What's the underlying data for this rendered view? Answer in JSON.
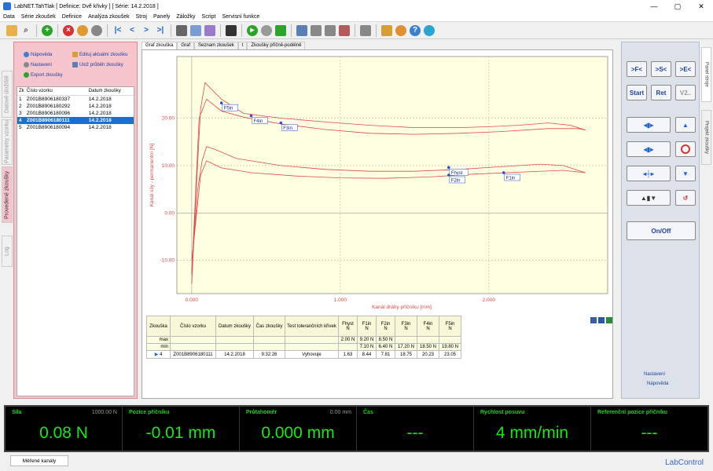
{
  "window": {
    "title": "LabNET.TahTlak [ Definice: Dvě křivky ]  [ Série: 14.2.2018 ]",
    "controls": [
      "—",
      "▢",
      "✕"
    ]
  },
  "menu": [
    "Data",
    "Série zkoušek",
    "Definice",
    "Analýza zkoušek",
    "Stroj",
    "Panely",
    "Záložky",
    "Script",
    "Servisní funkce"
  ],
  "left_tabs": [
    "Datové úložiště",
    "Parametry vzorku",
    "Provedené zkoušky",
    "Log"
  ],
  "left_links": {
    "help": "Nápověda",
    "settings": "Nastavení",
    "export": "Export zkoušky",
    "edit": "Edituj aktuální zkoušku",
    "save_curve": "Ulož průběh zkoušky"
  },
  "samples": {
    "headers": [
      "Zk",
      "Číslo vzorku",
      "Datum zkoušky"
    ],
    "rows": [
      {
        "n": "1",
        "id": "Z001B8906180337",
        "date": "14.2.2018"
      },
      {
        "n": "2",
        "id": "Z001B8906180292",
        "date": "14.2.2018"
      },
      {
        "n": "3",
        "id": "Z001B8906180096",
        "date": "14.2.2018"
      },
      {
        "n": "4",
        "id": "Z001B8906180111",
        "date": "14.2.2018"
      },
      {
        "n": "5",
        "id": "Z001B8906180094",
        "date": "14.2.2018"
      }
    ]
  },
  "center_tabs": [
    "Graf zkouška",
    "Graf",
    "Seznam zkoušek",
    "t",
    "Zkoušky příčně-podélně"
  ],
  "chart_data": {
    "type": "line",
    "xlabel": "Kanál dráhy příčníku  [mm]",
    "ylabel": "Kanál síly - permanentní  [N]",
    "xticks": [
      "0.000",
      "1.000",
      "2.000"
    ],
    "yticks": [
      "20.00",
      "10.00",
      "0.00",
      "-10.00"
    ],
    "xlim": [
      -0.1,
      2.8
    ],
    "ylim": [
      -17,
      33
    ],
    "grid": true,
    "series": [
      {
        "x": [
          0.0,
          0.03,
          0.06,
          0.09,
          0.12,
          0.2,
          0.35,
          0.6,
          0.9,
          1.2,
          1.5,
          1.8,
          2.0,
          2.2,
          2.4,
          2.55,
          2.65
        ],
        "y": [
          -15,
          5,
          22,
          27.5,
          26.5,
          24,
          21,
          20,
          19.2,
          18.5,
          18,
          18,
          18.2,
          18.5,
          19,
          18.5,
          17.5
        ]
      },
      {
        "x": [
          0.0,
          0.05,
          0.1,
          0.2,
          0.35,
          0.6,
          0.9,
          1.2,
          1.5,
          1.8,
          2.1,
          2.4,
          2.6,
          2.65
        ],
        "y": [
          -13,
          20,
          24,
          21.5,
          20.2,
          18.8,
          17.6,
          16.8,
          16.6,
          16.8,
          17.2,
          17.8,
          17.8,
          17.5
        ]
      },
      {
        "x": [
          0.0,
          0.04,
          0.07,
          0.1,
          0.15,
          0.3,
          0.6,
          0.9,
          1.2,
          1.5,
          1.8,
          2.1,
          2.35,
          2.5,
          2.65
        ],
        "y": [
          -12,
          5,
          11,
          14,
          13.5,
          11.5,
          10,
          9.2,
          8.8,
          8.8,
          9.2,
          9.8,
          10.3,
          10,
          8.5
        ]
      },
      {
        "x": [
          0.0,
          0.06,
          0.1,
          0.2,
          0.4,
          0.7,
          1.0,
          1.3,
          1.6,
          1.9,
          2.2,
          2.5,
          2.65
        ],
        "y": [
          -10,
          8,
          11,
          9.5,
          8.5,
          7.8,
          7.4,
          7.3,
          7.6,
          8.2,
          8.6,
          9.0,
          8.5
        ]
      }
    ],
    "markers": [
      {
        "label": "F5in",
        "x": 0.2,
        "y": 23.2
      },
      {
        "label": "F4in",
        "x": 0.4,
        "y": 20.5
      },
      {
        "label": "F3in",
        "x": 0.6,
        "y": 19.0
      },
      {
        "label": "Fhyst",
        "x": 1.73,
        "y": 9.6
      },
      {
        "label": "F2in",
        "x": 1.73,
        "y": 8.0
      },
      {
        "label": "F1in",
        "x": 2.1,
        "y": 8.5
      }
    ]
  },
  "results": {
    "headers": [
      "Zkouška",
      "Číslo vzorku",
      "Datum zkoušky",
      "Čas zkoušky",
      "Test tolerančních křivek",
      "Fhyst\nN",
      "F1in\nN",
      "F2in\nN",
      "F3in\nN",
      "F4in\nN",
      "F5in\nN"
    ],
    "max": [
      "2.00 N",
      "9.20 N",
      "8.50 N",
      "",
      "",
      ""
    ],
    "min": [
      "",
      "7.10 N",
      "6.40 N",
      "17.20 N",
      "18.50 N",
      "19.80 N"
    ],
    "row": [
      "4",
      "Z001B8906180111",
      "14.2.2018",
      "9:32:26",
      "Vyhovuje",
      "1.63",
      "8.44",
      "7.81",
      "18.75",
      "20.23",
      "23.05"
    ]
  },
  "right_panel": {
    "buttons": [
      ">F<",
      ">S<",
      ">E<",
      "Start",
      "Ret",
      "V2..",
      "On/Off"
    ],
    "links": [
      "Nastavení",
      "Nápověda"
    ],
    "tabs": [
      "Panel stroje",
      "Projekt zkoušky"
    ]
  },
  "meters": [
    {
      "label": "Síla",
      "range": "1000.00 N",
      "value": "0.08 N"
    },
    {
      "label": "Pozice příčníku",
      "range": "",
      "value": "-0.01 mm"
    },
    {
      "label": "Průtahoměr",
      "range": "0.00 mm",
      "value": "0.000 mm"
    },
    {
      "label": "Čas",
      "range": "",
      "value": "---"
    },
    {
      "label": "Rychlost posuvu",
      "range": "",
      "value": "4 mm/min"
    },
    {
      "label": "Referenční pozice příčníku",
      "range": "",
      "value": "---"
    }
  ],
  "bottom_tab": "Měřené kanály",
  "brand": "LabControl",
  "colors": {
    "curve": "#e04848",
    "plot_bg": "#ffffe1",
    "panel_pink": "#f6c4cd",
    "meter_green": "#15e915"
  }
}
